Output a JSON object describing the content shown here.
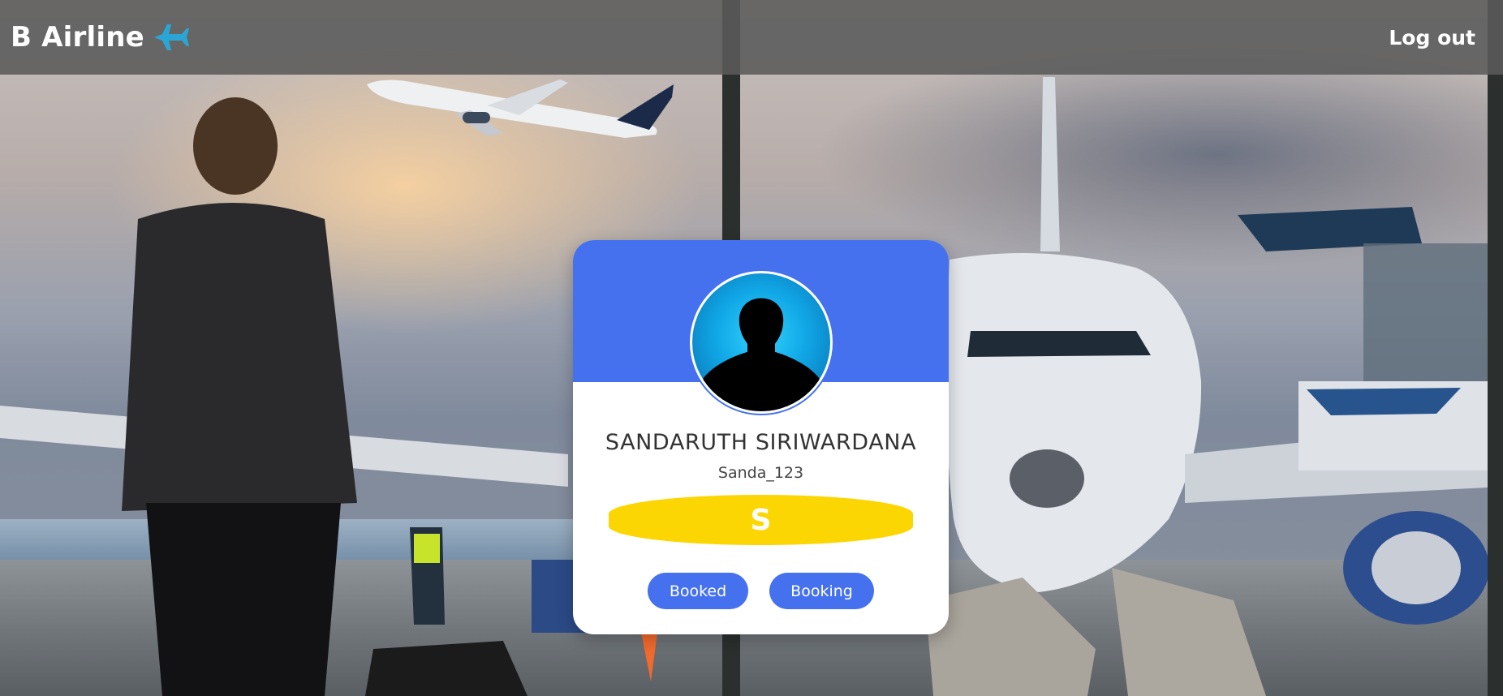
{
  "navbar": {
    "brand": "B Airline",
    "brand_icon": "airplane-icon",
    "logout_label": "Log out"
  },
  "profile": {
    "avatar_icon": "user-silhouette-icon",
    "full_name": "SANDARUTH SIRIWARDANA",
    "username": "Sanda_123",
    "initial": "S"
  },
  "actions": {
    "booked_label": "Booked",
    "booking_label": "Booking"
  },
  "colors": {
    "accent_blue": "#4571ef",
    "badge_yellow": "#fcd602",
    "plane_icon_blue": "#2aa6d6",
    "navbar_gray": "#5a5a5a"
  }
}
